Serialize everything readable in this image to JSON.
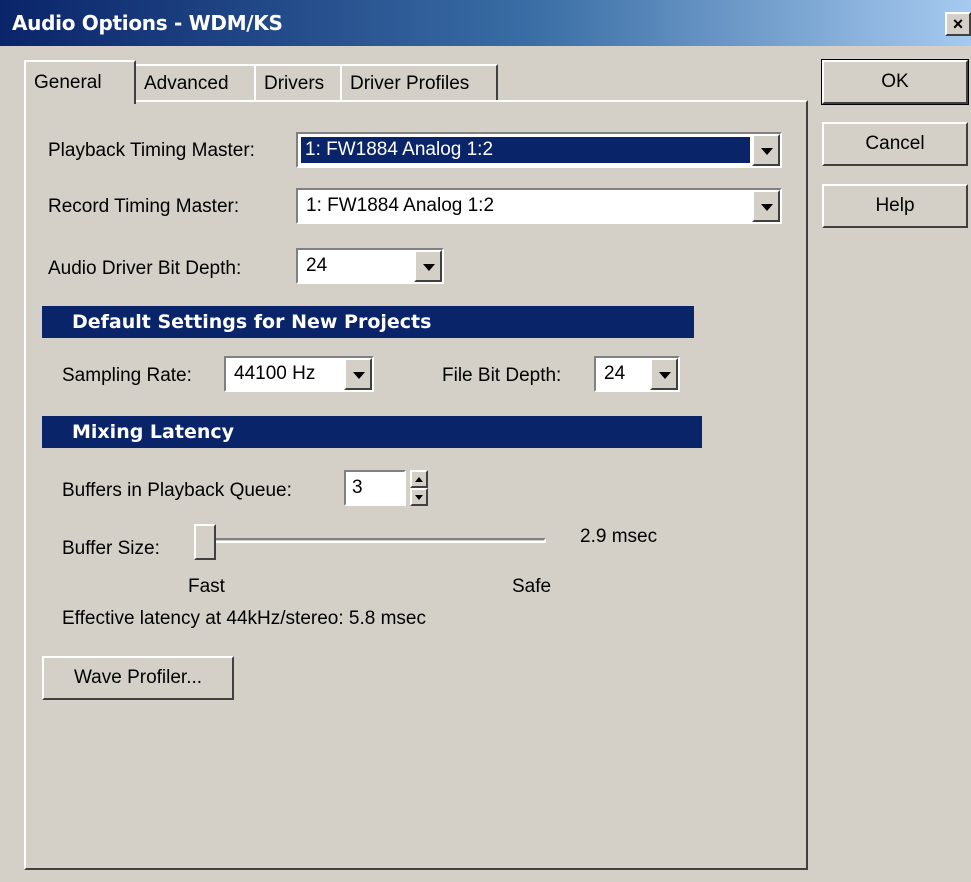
{
  "window": {
    "title": "Audio Options - WDM/KS",
    "close_label": "×"
  },
  "tabs": [
    {
      "label": "General",
      "active": true
    },
    {
      "label": "Advanced"
    },
    {
      "label": "Drivers"
    },
    {
      "label": "Driver Profiles"
    }
  ],
  "general": {
    "playback_label": "Playback Timing Master:",
    "playback_value": "1: FW1884 Analog 1:2",
    "record_label": "Record Timing Master:",
    "record_value": "1: FW1884 Analog 1:2",
    "bitdepth_label": "Audio Driver Bit Depth:",
    "bitdepth_value": "24"
  },
  "defaults_section": {
    "header": "Default Settings for New Projects",
    "sampling_label": "Sampling Rate:",
    "sampling_value": "44100 Hz",
    "file_bitdepth_label": "File Bit Depth:",
    "file_bitdepth_value": "24"
  },
  "latency_section": {
    "header": "Mixing Latency",
    "buffers_label": "Buffers in Playback Queue:",
    "buffers_value": "3",
    "buffer_size_label": "Buffer Size:",
    "buffer_size_value": "2.9 msec",
    "slider_min_label": "Fast",
    "slider_max_label": "Safe",
    "slider_level_fraction": 0.0,
    "effective_latency": "Effective latency at 44kHz/stereo:  5.8 msec"
  },
  "buttons": {
    "wave_profiler": "Wave Profiler...",
    "ok": "OK",
    "cancel": "Cancel",
    "help": "Help"
  }
}
